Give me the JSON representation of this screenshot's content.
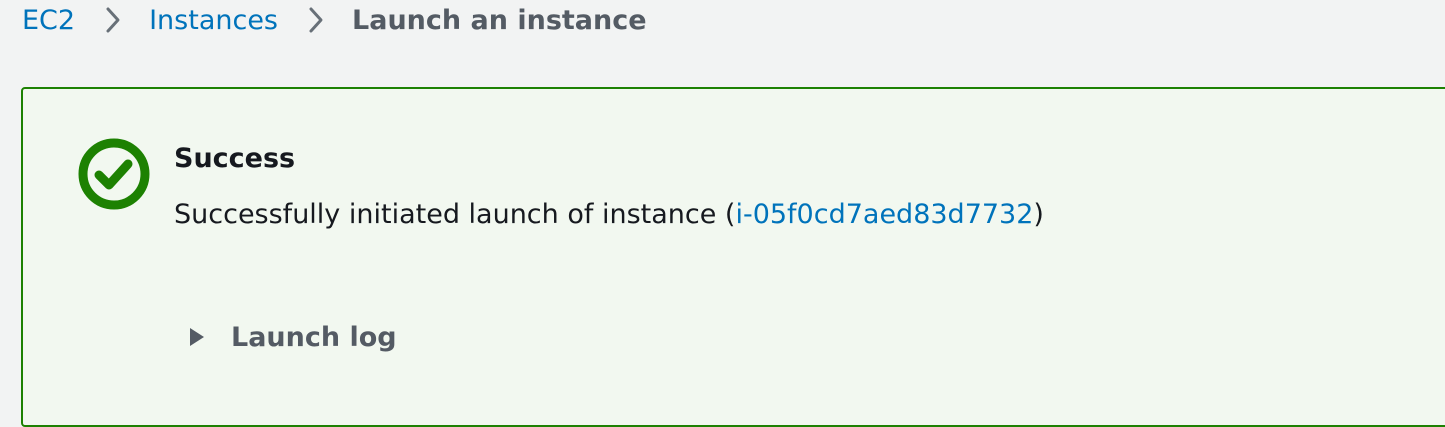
{
  "breadcrumb": {
    "items": [
      {
        "label": "EC2"
      },
      {
        "label": "Instances"
      }
    ],
    "current": "Launch an instance",
    "separator_icon": "chevron-right-icon"
  },
  "flash": {
    "type": "success",
    "status_icon": "check-circle-icon",
    "title": "Success",
    "message_prefix": "Successfully initiated launch of instance (",
    "instance_id": "i-05f0cd7aed83d7732",
    "message_suffix": ")",
    "expander_icon": "caret-right-icon",
    "expander_label": "Launch log"
  },
  "colors": {
    "link": "#0073bb",
    "success": "#1d8102",
    "success_bg": "#f2f8f0",
    "page_bg": "#f2f3f3",
    "muted_text": "#545b64"
  }
}
